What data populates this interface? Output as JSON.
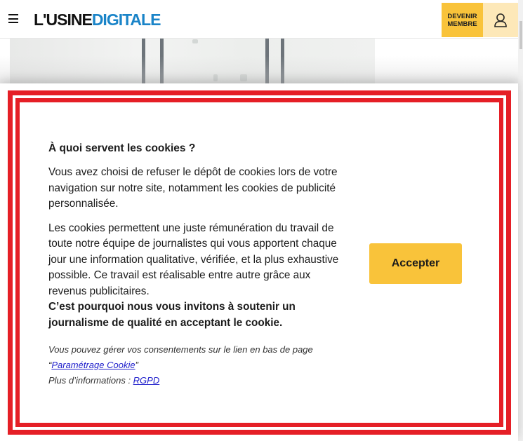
{
  "header": {
    "logo_part1": "L'USINE",
    "logo_part2": "DIGITALE",
    "member_line1": "DEVENIR",
    "member_line2": "MEMBRE",
    "brand_color": "#1a84c8",
    "accent_color": "#f9c33a"
  },
  "cookie_modal": {
    "title": "À quoi servent les cookies ?",
    "paragraph1": "Vous avez choisi de refuser le dépôt de cookies lors de votre navigation sur notre site, notamment les cookies de publicité personnalisée.",
    "paragraph2": "Les cookies permettent une juste rémunération du travail de toute notre équipe de journalistes qui vous apportent chaque jour une information qualitative, vérifiée, et la plus exhaustive possible. Ce travail est réalisable entre autre grâce aux revenus publicitaires.",
    "paragraph2_bold": "C’est pourquoi nous vous invitons à soutenir un journalisme de qualité en acceptant le cookie.",
    "manage_text": "Vous pouvez gérer vos consentements sur le lien en bas de page",
    "quote_open": "“",
    "settings_link": "Paramétrage Cookie",
    "quote_close": "”",
    "more_info_text": "Plus d’informations : ",
    "rgpd_link": "RGPD",
    "accept_label": "Accepter",
    "frame_color": "#e51f26"
  }
}
